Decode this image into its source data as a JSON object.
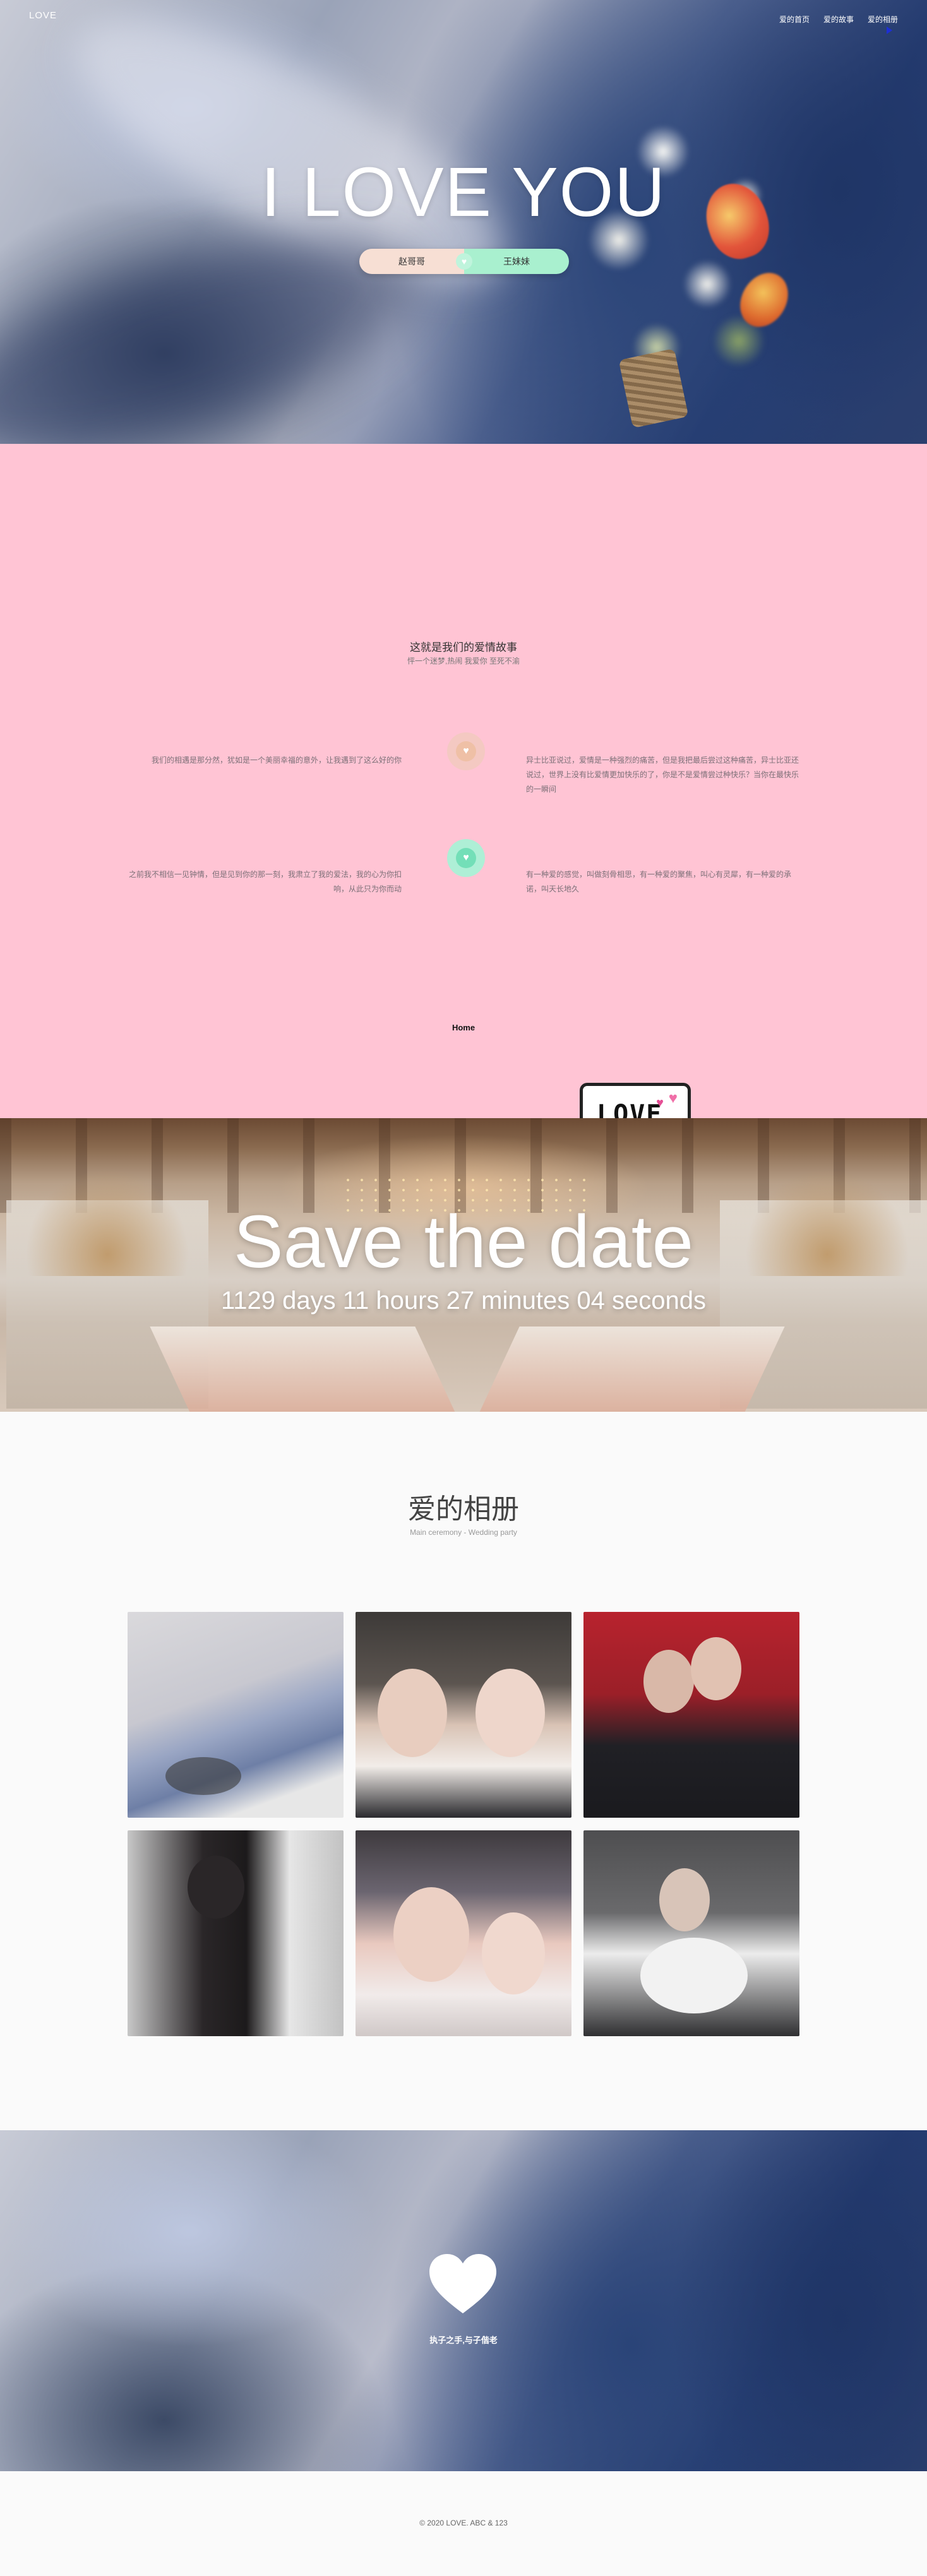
{
  "header": {
    "logo": "LOVE",
    "nav": [
      "爱的首页",
      "爱的故事",
      "爱的相册"
    ]
  },
  "hero": {
    "title": "I LOVE YOU",
    "left_name": "赵哥哥",
    "right_name": "王妹妹"
  },
  "story": {
    "title": "这就是我们的爱情故事",
    "subtitle": "怦一个迷梦,热闹 我爱你 至死不渝",
    "entries": [
      {
        "left": "我们的相遇是那分然，犹如是一个美丽幸福的意外，让我遇到了这么好的你",
        "right": "异士比亚说过，爱情是一种强烈的痛苦，但是我把最后尝过这种痛苦，异士比亚还说过，世界上没有比爱情更加快乐的了，你是不是爱情尝过种快乐？当你在最快乐的一瞬间"
      },
      {
        "left": "之前我不相信一见钟情，但是见到你的那一刻，我肃立了我的爱法，我的心为你扣响，从此只为你而动",
        "right": "有一种爱的感觉，叫做刻骨相思，有一种爱的聚焦，叫心有灵犀，有一种爱的承诺，叫天长地久"
      }
    ],
    "home_link": "Home",
    "sign_text": "LOVE"
  },
  "save_the_date": {
    "title": "Save the date",
    "countdown": "1129 days 11 hours 27 minutes 04 seconds"
  },
  "album": {
    "title": "爱的相册",
    "subtitle": "Main ceremony - Wedding party"
  },
  "closing": {
    "text": "执子之手,与子偕老"
  },
  "footer": {
    "copyright": "© 2020 LOVE. ABC & 123"
  },
  "colors": {
    "story_bg": "#ffc4d4",
    "pill_left": "#f7dfd4",
    "pill_right": "#a9f0cf",
    "dot_pink": "#efc0a6",
    "dot_green": "#73dfb8"
  }
}
